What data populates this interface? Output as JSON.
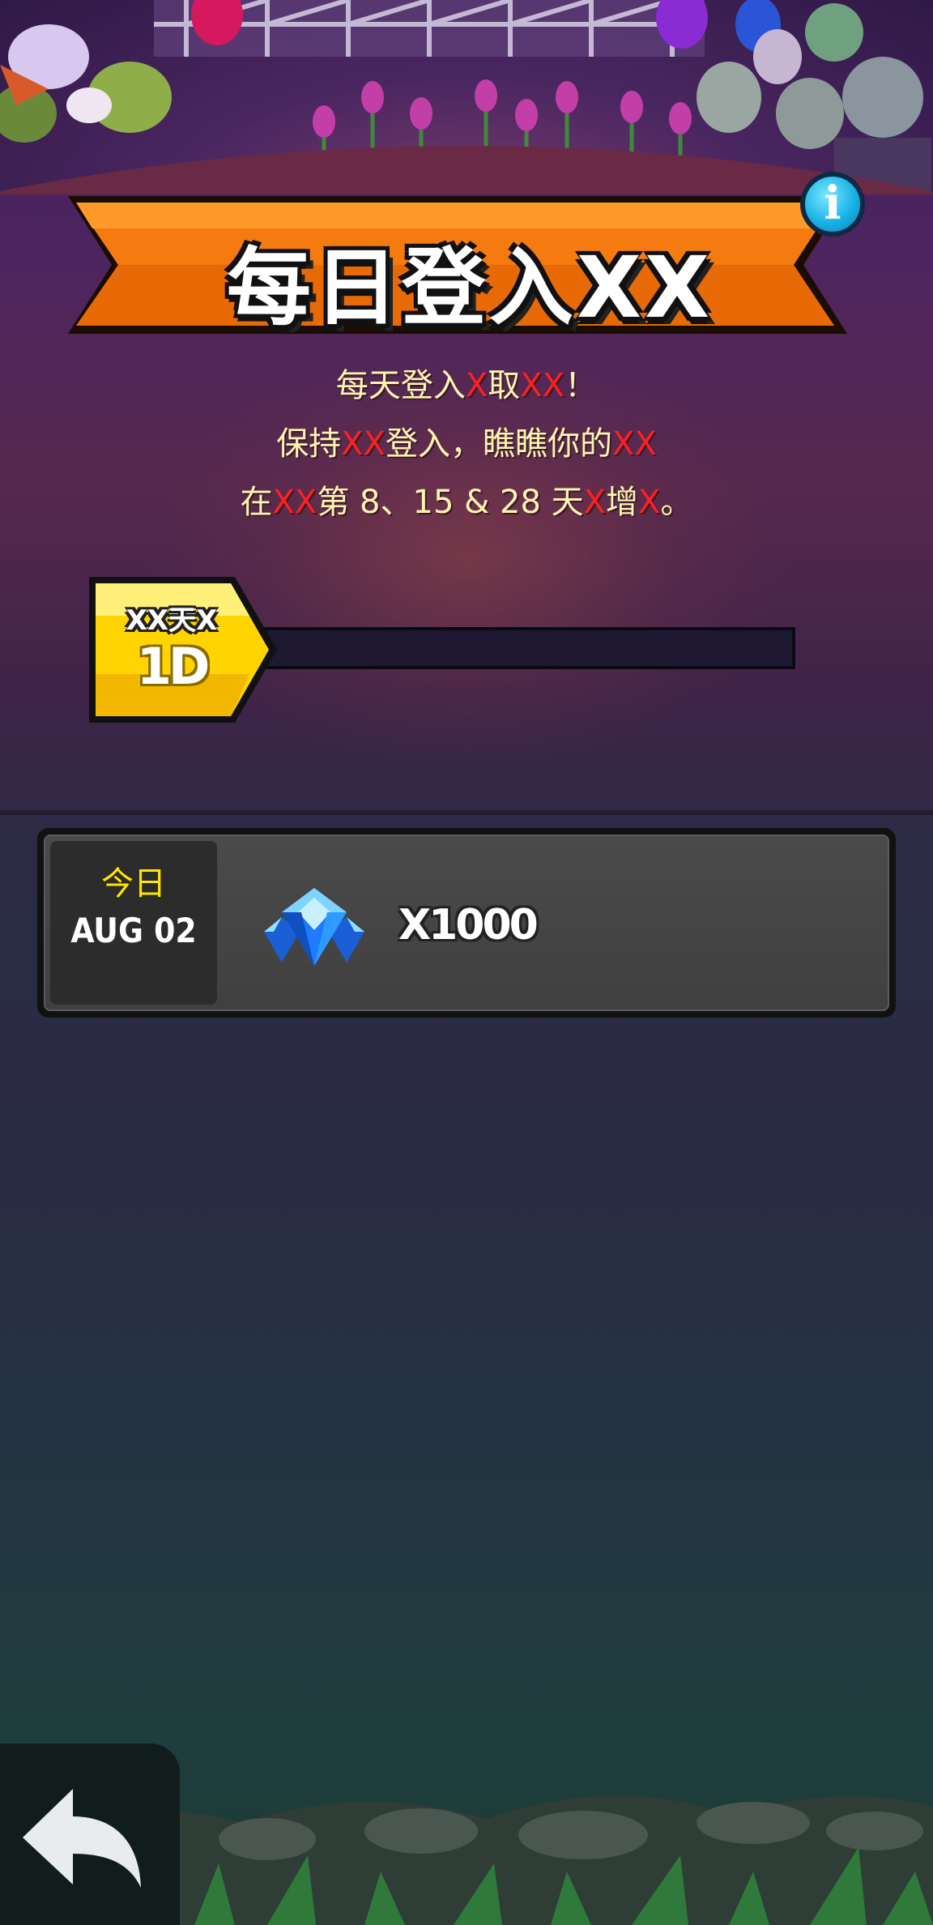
{
  "header": {
    "title": "每日登入XX"
  },
  "description": {
    "line1": [
      {
        "text": "每天登入",
        "red": false
      },
      {
        "text": "X",
        "red": true
      },
      {
        "text": "取",
        "red": false
      },
      {
        "text": "XX",
        "red": true
      },
      {
        "text": "！",
        "red": false
      }
    ],
    "line2": [
      {
        "text": "保持",
        "red": false
      },
      {
        "text": "XX",
        "red": true
      },
      {
        "text": "登入，瞧瞧你的",
        "red": false
      },
      {
        "text": "XX",
        "red": true
      }
    ],
    "line3": [
      {
        "text": "在",
        "red": false
      },
      {
        "text": "XX",
        "red": true
      },
      {
        "text": "第 8、15 & 28 天",
        "red": false
      },
      {
        "text": "X",
        "red": true
      },
      {
        "text": "增",
        "red": false
      },
      {
        "text": "X",
        "red": true
      },
      {
        "text": "。",
        "red": false
      }
    ]
  },
  "streak": {
    "label": "XX天X",
    "value": "1D",
    "progress": 0
  },
  "reward": {
    "day_label": "今日",
    "date": "AUG 02",
    "item_icon": "gem-icon",
    "amount": "X1000"
  },
  "colors": {
    "banner_orange": "#f57a10",
    "badge_yellow": "#ffd400",
    "highlight_red": "#ff2020",
    "text_cream": "#fff3b0",
    "info_blue": "#19b3e6"
  }
}
